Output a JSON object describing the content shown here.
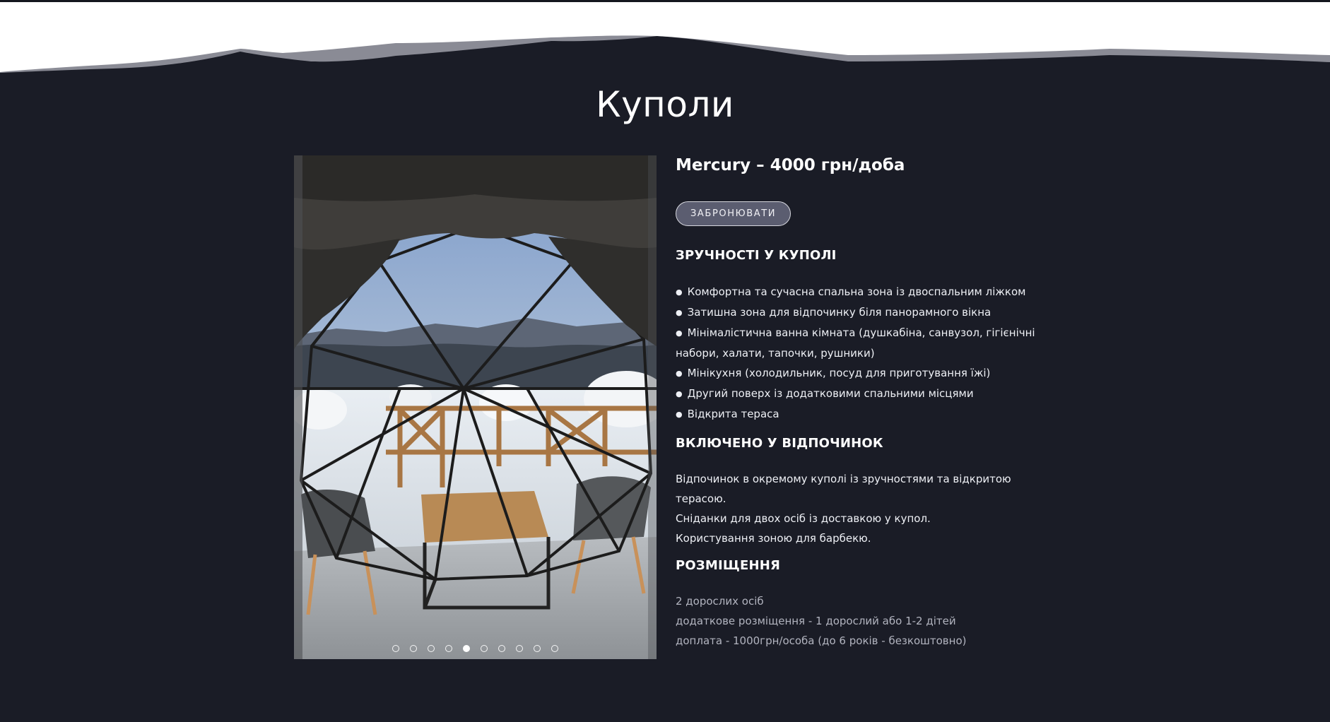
{
  "section": {
    "title": "Куполи"
  },
  "colors": {
    "background": "#1a1c26",
    "wave_white": "#ffffff",
    "wave_grey": "#8a8b95",
    "button_fill": "#5b5d70"
  },
  "room": {
    "price_title": "Mercury – 4000 грн/доба",
    "book_button_label": "ЗАБРОНЮВАТИ",
    "amenities_heading": "ЗРУЧНОСТІ У КУПОЛІ",
    "amenities": [
      "Комфортна та сучасна спальна зона із двоспальним ліжком",
      "Затишна зона для відпочинку біля панорамного вікна",
      "Мінімалістична ванна кімната (душкабіна, санвузол, гігієнічні набори, халати, тапочки, рушники)",
      "Мінікухня (холодильник, посуд для приготування їжі)",
      "Другий поверх із додатковими спальними місцями",
      "Відкрита тераса"
    ],
    "included_heading": "ВКЛЮЧЕНО У ВІДПОЧИНОК",
    "included": [
      "Відпочинок в окремому куполі із зручностями та відкритою терасою.",
      "Сніданки для двох осіб із доставкою у купол.",
      "Користування зоною для барбекю."
    ],
    "accommodation_heading": "РОЗМІЩЕННЯ",
    "accommodation": [
      "2 дорослих осіб",
      "додаткове розміщення - 1 дорослий або 1-2 дітей",
      "доплата - 1000грн/особа (до 6 років - безкоштовно)"
    ]
  },
  "slider": {
    "image_icon": "dome-interior-photo",
    "dot_count": 10,
    "active_index": 4
  }
}
